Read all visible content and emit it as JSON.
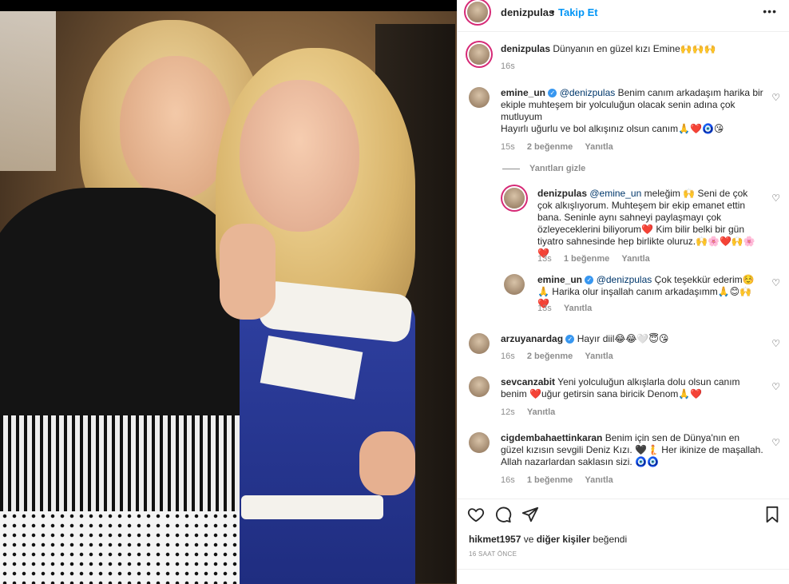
{
  "post": {
    "username": "denizpulas",
    "follow_label": "Takip Et",
    "more_label": "•••",
    "dot": "•"
  },
  "comments": [
    {
      "user": "denizpulas",
      "text": "Dünyanın en güzel kızı Emine🙌🙌🙌",
      "time": "16s"
    },
    {
      "user": "emine_un",
      "mention": "@denizpulas",
      "text": " Benim canım arkadaşım harika bir ekiple muhteşem bir yolculuğun olacak senin adına çok mutluyum",
      "text2": "Hayırlı uğurlu ve bol alkışınız olsun canım🙏❤️🧿😘",
      "time": "15s",
      "likes": "2 beğenme",
      "reply": "Yanıtla"
    },
    {
      "user": "denizpulas",
      "mention": "@emine_un",
      "text": " meleğim 🙌 Seni de çok çok alkışlıyorum. Muhteşem bir ekip emanet ettin bana. Seninle aynı sahneyi paylaşmayı çok özleyeceklerini biliyorum❤️ Kim bilir belki bir gün tiyatro sahnesinde hep birlikte oluruz.🙌🌸❤️🙌🌸❤️",
      "time": "13s",
      "likes": "1 beğenme",
      "reply": "Yanıtla"
    },
    {
      "user": "emine_un",
      "mention": "@denizpulas",
      "text": " Çok teşekkür ederim☺️ 🙏 Harika olur inşallah canım arkadaşımm🙏😊🙌❤️",
      "time": "13s",
      "reply": "Yanıtla"
    },
    {
      "user": "arzuyanardag",
      "text": " Hayır diil😂😂🤍😇😘",
      "time": "16s",
      "likes": "2 beğenme",
      "reply": "Yanıtla"
    },
    {
      "user": "sevcanzabit",
      "text": " Yeni yolculuğun alkışlarla dolu olsun canım benim ❤️uğur getirsin sana biricik Denom🙏❤️",
      "time": "12s",
      "reply": "Yanıtla"
    },
    {
      "user": "cigdembahaettinkaran",
      "text": " Benim için sen de Dünya'nın en güzel kızısın sevgili Deniz Kızı. 🖤🧜 Her ikinize de maşallah. Allah nazarlardan saklasın sizi. 🧿🧿",
      "time": "16s",
      "likes": "1 beğenme",
      "reply": "Yanıtla"
    }
  ],
  "hide_replies": "Yanıtları gizle",
  "likes_line": {
    "user": "hikmet1957",
    "mid": " ve ",
    "others": "diğer kişiler",
    "end": " beğendi"
  },
  "timestamp": "16 SAAT ÖNCE",
  "icons": [
    "heart-icon",
    "comment-icon",
    "share-icon",
    "bookmark-icon"
  ],
  "colors": {
    "link": "#0095f6",
    "mention": "#00376b",
    "muted": "#8e8e8e",
    "ring": "#d62976"
  }
}
